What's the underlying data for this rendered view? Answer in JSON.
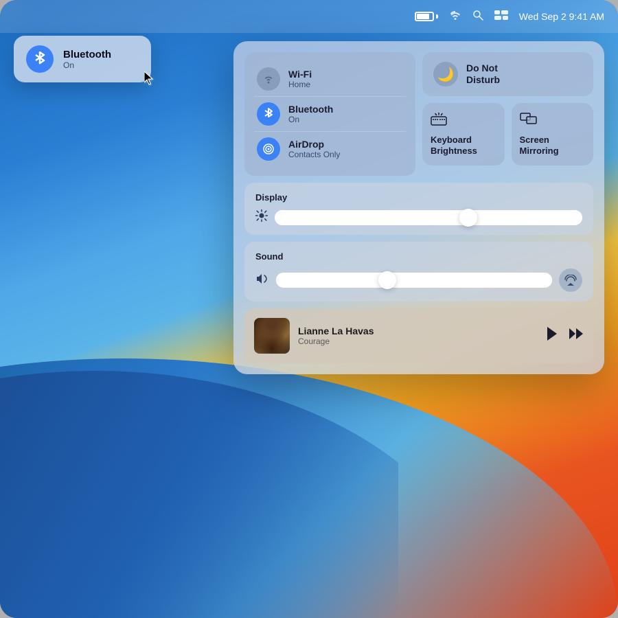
{
  "menubar": {
    "datetime": "Wed Sep 2  9:41 AM"
  },
  "bluetooth_tooltip": {
    "title": "Bluetooth",
    "status": "On",
    "icon": "✱"
  },
  "control_center": {
    "network_tile": {
      "wifi": {
        "name": "Wi-Fi",
        "status": "Home"
      },
      "bluetooth": {
        "name": "Bluetooth",
        "status": "On",
        "icon": "✱"
      },
      "airdrop": {
        "name": "AirDrop",
        "status": "Contacts Only"
      }
    },
    "dnd": {
      "label_line1": "Do Not",
      "label_line2": "Disturb"
    },
    "keyboard_brightness": {
      "label": "Keyboard Brightness"
    },
    "screen_mirroring": {
      "label": "Screen Mirroring"
    },
    "display_section": {
      "label": "Display",
      "slider_value": 65
    },
    "sound_section": {
      "label": "Sound",
      "slider_value": 40
    },
    "now_playing": {
      "title": "Lianne La Havas",
      "subtitle": "Courage"
    }
  }
}
